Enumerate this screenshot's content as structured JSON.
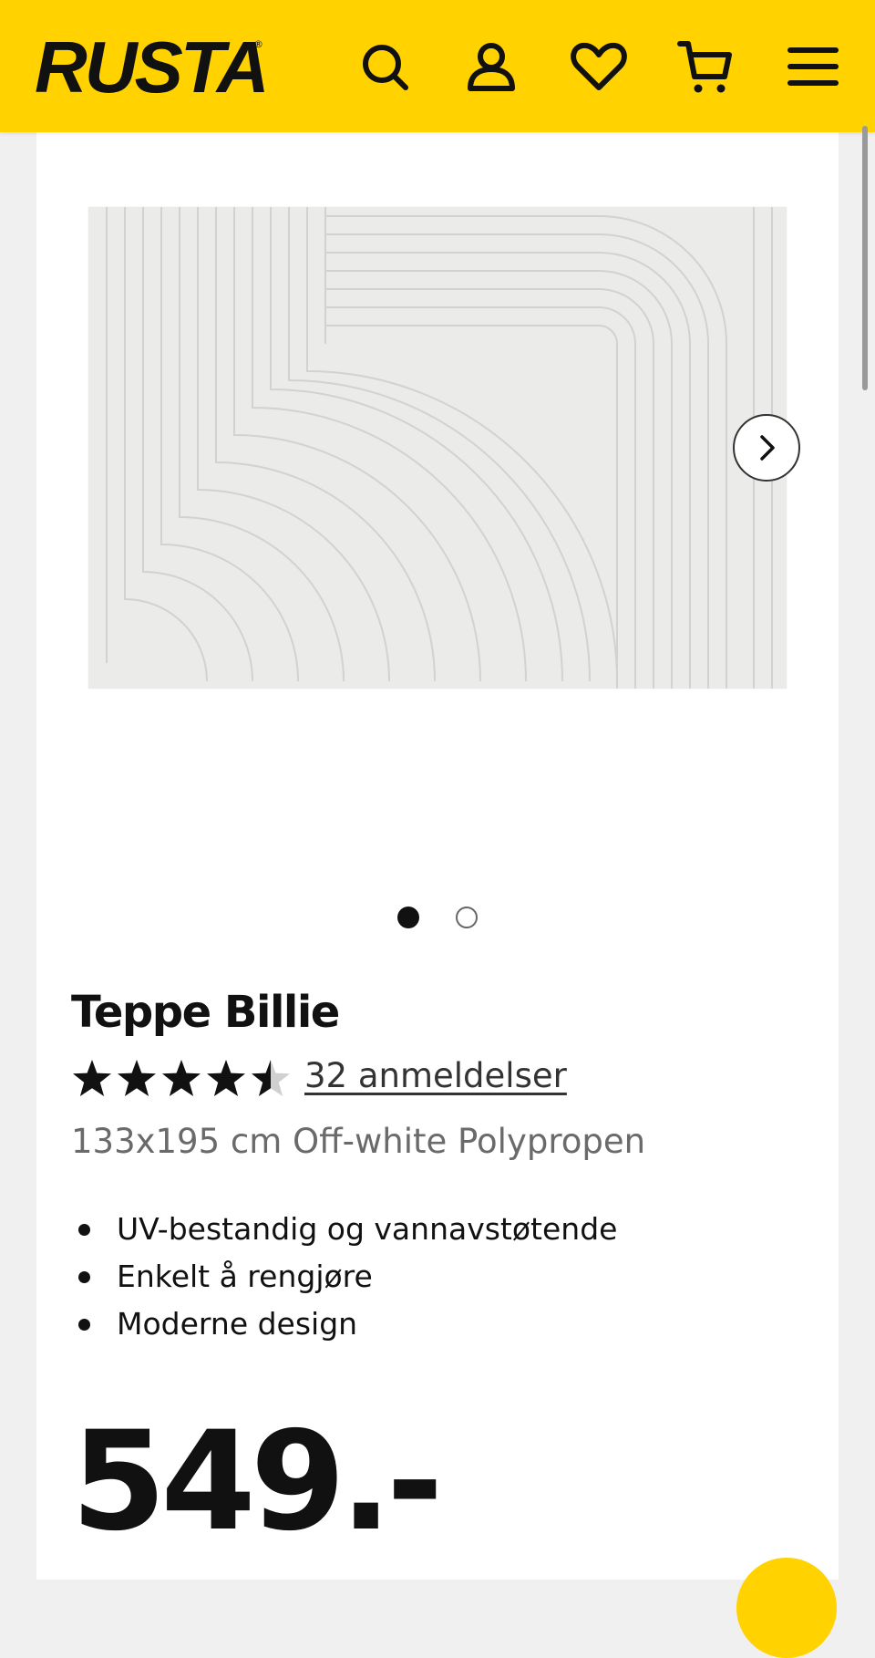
{
  "header": {
    "logo": "RUSTA",
    "logo_mark": "®",
    "icons": [
      "search-icon",
      "account-icon",
      "heart-icon",
      "cart-icon",
      "menu-icon"
    ],
    "background": "#ffd200"
  },
  "gallery": {
    "image_alt": "Teppe Billie",
    "next_icon": "chevron-right-icon",
    "total_images": 2,
    "active_index": 1
  },
  "product": {
    "title": "Teppe Billie",
    "rating": 4.5,
    "rating_max": 5,
    "reviews": "32 anmeldelser",
    "variant": "133x195 cm Off-white Polypropen",
    "features": [
      "UV-bestandig og vannavstøtende",
      "Enkelt å rengjøre",
      "Moderne design"
    ],
    "price": "549.-"
  }
}
